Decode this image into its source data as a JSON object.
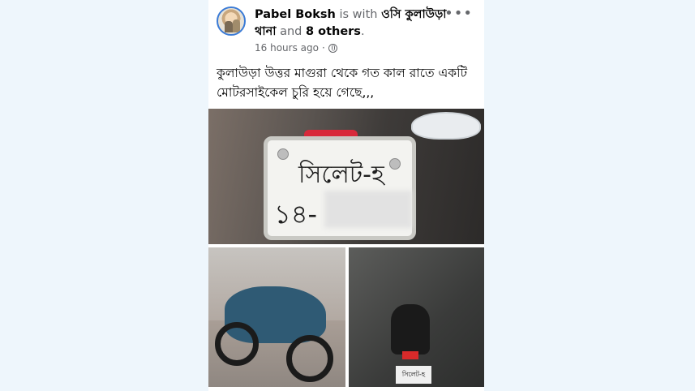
{
  "post": {
    "author": "Pabel Boksh",
    "with_text": "is with",
    "tagged": "ওসি কুলাউড়া থানা",
    "and_text": "and",
    "others": "8 others",
    "period": ".",
    "time": "16 hours ago",
    "separator": "·",
    "privacy_icon": "globe-icon",
    "more_icon": "•••",
    "text": "কুলাউড়া উত্তর মাগুরা থেকে গত কাল রাতে একটি মোটরসাইকেল চুরি হয়ে গেছে,,,",
    "photos": {
      "plate_line1": "সিলেট-হ",
      "plate_line2": "১৪-",
      "small_plate": "সিলেট-হ"
    }
  },
  "colors": {
    "background": "#eef6fc",
    "card": "#ffffff",
    "secondary_text": "#65676b",
    "primary_text": "#050505"
  }
}
